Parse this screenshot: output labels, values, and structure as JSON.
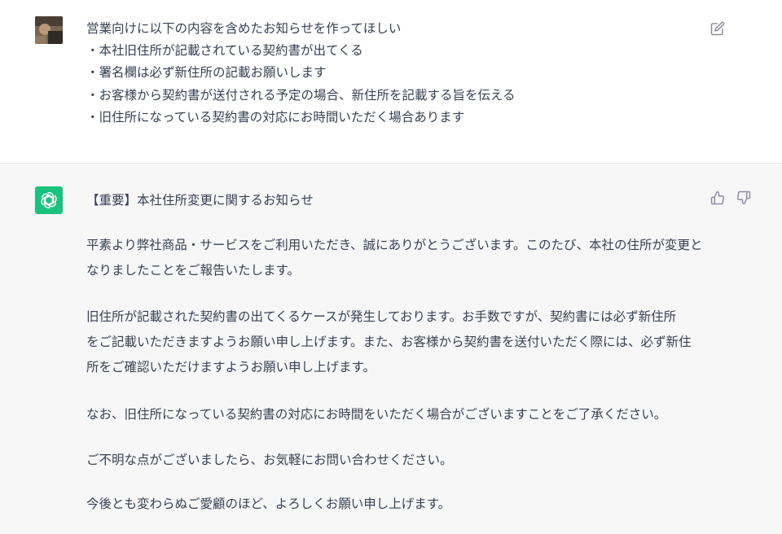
{
  "user_message": {
    "lines": [
      "営業向けに以下の内容を含めたお知らせを作ってほしい",
      "・本社旧住所が記載されている契約書が出てくる",
      "・署名欄は必ず新住所の記載お願いします",
      "・お客様から契約書が送付される予定の場合、新住所を記載する旨を伝える",
      "・旧住所になっている契約書の対応にお時間いただく場合あります"
    ],
    "edit_icon": "edit-icon"
  },
  "assistant_message": {
    "title": "【重要】本社住所変更に関するお知らせ",
    "paragraphs": [
      [
        "平素より弊社商品・サービスをご利用いただき、誠にありがとうございます。このたび、本社の住所が変更と",
        "なりましたことをご報告いたします。"
      ],
      [
        "旧住所が記載された契約書の出てくるケースが発生しております。お手数ですが、契約書には必ず新住所",
        "をご記載いただきますようお願い申し上げます。また、お客様から契約書を送付いただく際には、必ず新住",
        "所をご確認いただけますようお願い申し上げます。"
      ],
      [
        "なお、旧住所になっている契約書の対応にお時間をいただく場合がございますことをご了承ください。"
      ],
      [
        "ご不明な点がございましたら、お気軽にお問い合わせください。"
      ],
      [
        "今後とも変わらぬご愛顧のほど、よろしくお願い申し上げます。"
      ]
    ],
    "icons": [
      "thumbs-up-icon",
      "thumbs-down-icon"
    ]
  },
  "colors": {
    "assistant_bg": "#f7f7f8",
    "bot_avatar": "#19c37d",
    "text": "#374151",
    "icon": "#8e8ea0"
  }
}
